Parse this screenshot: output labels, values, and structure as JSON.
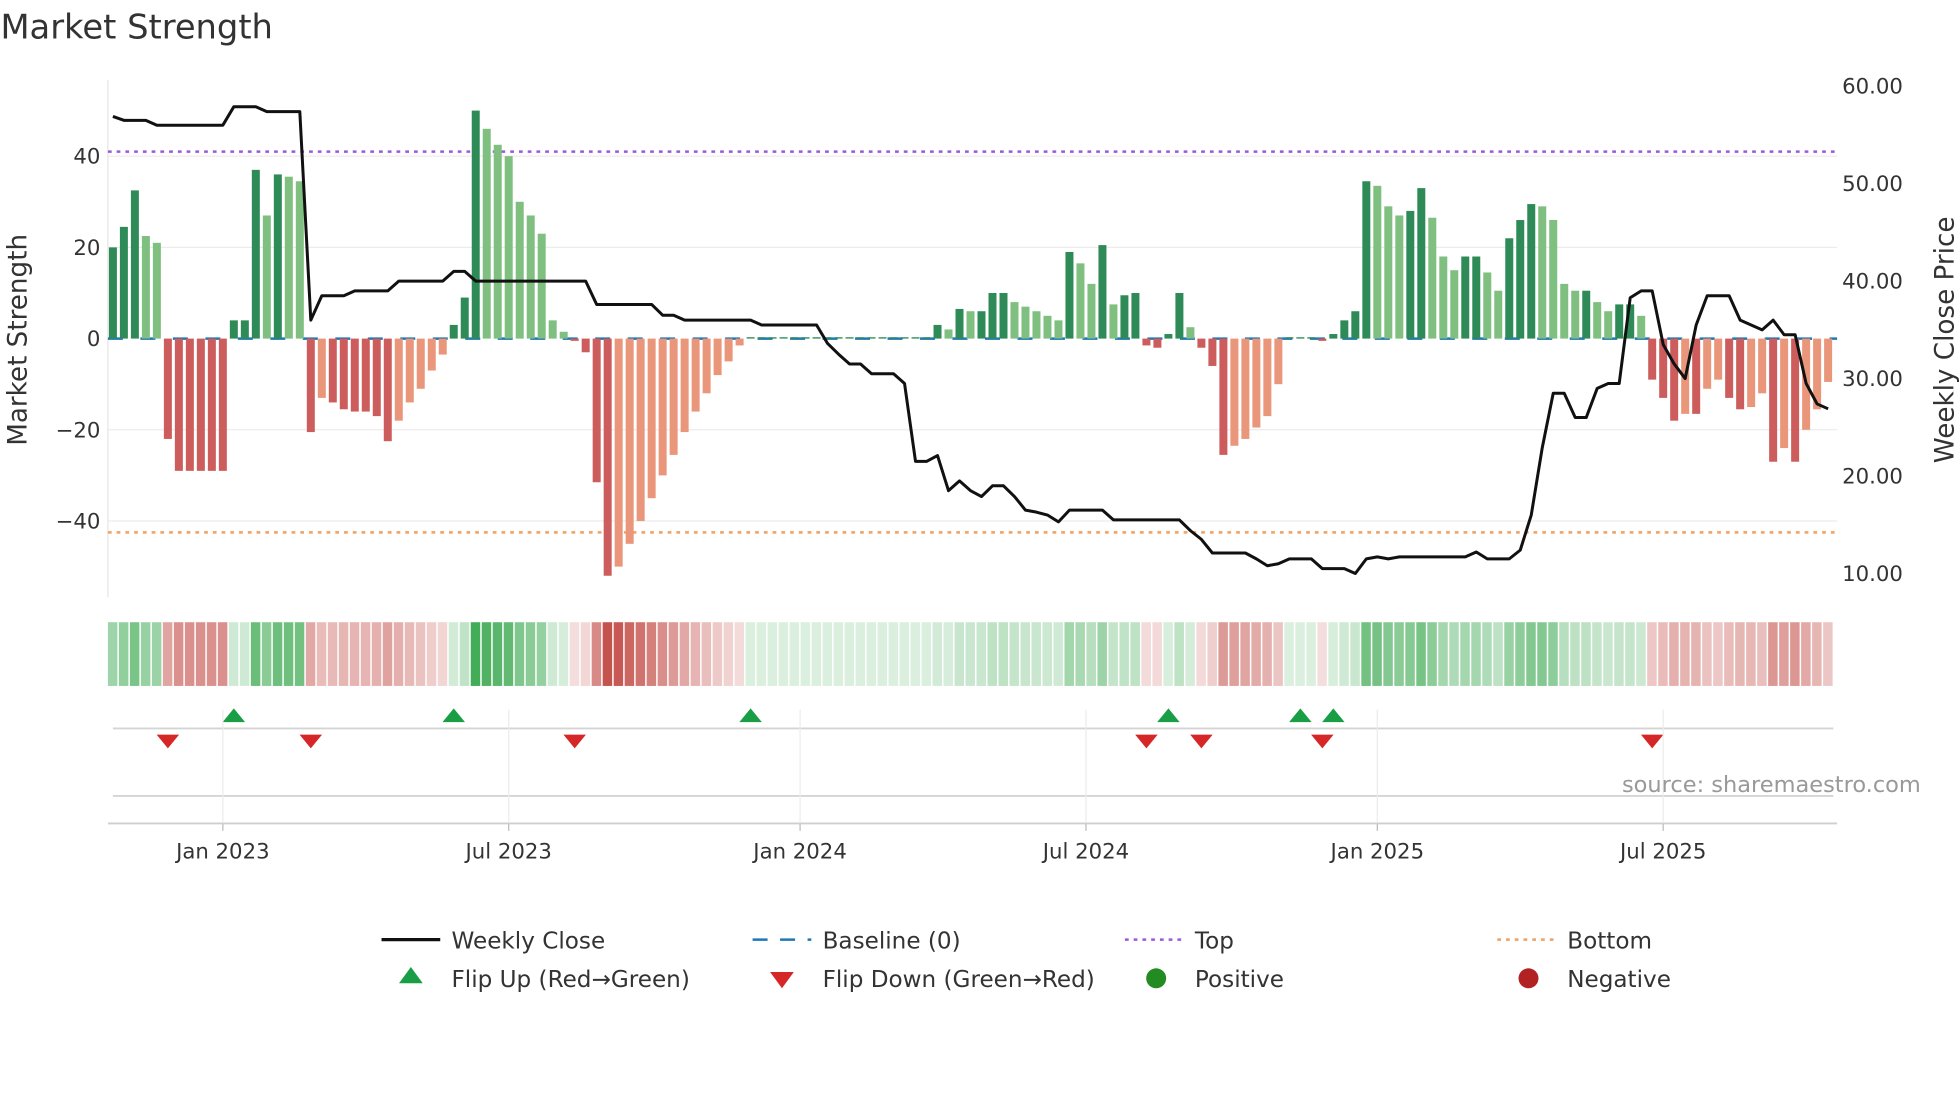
{
  "chart_data": {
    "type": "bar",
    "title": "Market Strength",
    "ylabel": "Market Strength",
    "y2label": "Weekly Close Price",
    "ylim": [
      -56,
      56
    ],
    "y2lim": [
      10,
      60
    ],
    "yticks": [
      40,
      20,
      0,
      -20,
      -40
    ],
    "ytick_labels": [
      "40",
      "20",
      "0",
      "−20",
      "−40"
    ],
    "y2ticks": [
      60,
      50,
      40,
      30,
      20,
      10
    ],
    "y2tick_labels": [
      "60.00",
      "50.00",
      "40.00",
      "30.00",
      "20.00",
      "10.00"
    ],
    "xtick_weeks": [
      10,
      36,
      62.5,
      88.5,
      115,
      141
    ],
    "xtick_labels": [
      "Jan 2023",
      "Jul 2023",
      "Jan 2024",
      "Jul 2024",
      "Jan 2025",
      "Jul 2025"
    ],
    "top_level": 41,
    "bottom_level": -42.5,
    "baseline": 0,
    "strength": [
      20,
      24.5,
      32.5,
      22.5,
      21,
      -22,
      -29,
      -29,
      -29,
      -29,
      -29,
      4,
      4,
      37,
      27,
      36,
      35.5,
      34.5,
      -20.5,
      -13,
      -14,
      -15.5,
      -16,
      -16,
      -17,
      -22.5,
      -18,
      -14,
      -11,
      -7,
      -3.5,
      3,
      9,
      50,
      46,
      42.5,
      40,
      30,
      27,
      23,
      4,
      1.5,
      -0.5,
      -3,
      -31.5,
      -52,
      -50,
      -45,
      -40,
      -35,
      -30,
      -25.5,
      -20.5,
      -16,
      -12,
      -8,
      -5,
      -1.5,
      0.3,
      0.3,
      0.3,
      0.3,
      0.3,
      0.3,
      0.3,
      0.3,
      0.3,
      0.3,
      0.3,
      0.3,
      0.3,
      0.3,
      0.3,
      0.3,
      0.3,
      3,
      2,
      6.5,
      6,
      6,
      10,
      10,
      8,
      7,
      6,
      5,
      4,
      19,
      16.5,
      12,
      20.5,
      7.5,
      9.5,
      10,
      -1.5,
      -2,
      1,
      10,
      2.5,
      -2,
      -6,
      -25.5,
      -23.5,
      -22,
      -19.5,
      -17,
      -10,
      0.3,
      0.3,
      0.3,
      -0.5,
      1,
      4,
      6,
      34.5,
      33.5,
      29,
      27,
      28,
      33,
      26.5,
      18,
      15,
      18,
      18,
      14.5,
      10.5,
      22,
      26,
      29.5,
      29,
      26,
      12,
      10.5,
      10.5,
      8,
      6,
      7.5,
      7.5,
      5,
      -9,
      -13,
      -18,
      -16.5,
      -16.5,
      -11,
      -9,
      -13,
      -15.5,
      -15,
      -12,
      -27,
      -24,
      -27,
      -20,
      -15.5,
      -9.5
    ],
    "weekly_close": [
      56.9,
      56.5,
      56.5,
      56.5,
      56.0,
      56.0,
      56.0,
      56.0,
      56.0,
      56.0,
      56.0,
      57.9,
      57.9,
      57.9,
      57.4,
      57.4,
      57.4,
      57.4,
      36.0,
      38.5,
      38.5,
      38.5,
      39.0,
      39.0,
      39.0,
      39.0,
      40.0,
      40.0,
      40.0,
      40.0,
      40.0,
      41.0,
      41.0,
      40.0,
      40.0,
      40.0,
      40.0,
      40.0,
      40.0,
      40.0,
      40.0,
      40.0,
      40.0,
      40.0,
      37.6,
      37.6,
      37.6,
      37.6,
      37.6,
      37.6,
      36.5,
      36.5,
      36.0,
      36.0,
      36.0,
      36.0,
      36.0,
      36.0,
      36.0,
      35.5,
      35.5,
      35.5,
      35.5,
      35.5,
      35.5,
      33.6,
      32.5,
      31.5,
      31.5,
      30.5,
      30.5,
      30.5,
      29.5,
      21.5,
      21.5,
      22.1,
      18.5,
      19.5,
      18.5,
      17.9,
      19.0,
      19.0,
      17.9,
      16.5,
      16.3,
      16.0,
      15.3,
      16.5,
      16.5,
      16.5,
      16.5,
      15.5,
      15.5,
      15.5,
      15.5,
      15.5,
      15.5,
      15.5,
      14.4,
      13.5,
      12.1,
      12.1,
      12.1,
      12.1,
      11.5,
      10.8,
      11.0,
      11.5,
      11.5,
      11.5,
      10.5,
      10.5,
      10.5,
      10.0,
      11.5,
      11.7,
      11.5,
      11.7,
      11.7,
      11.7,
      11.7,
      11.7,
      11.7,
      11.7,
      12.2,
      11.5,
      11.5,
      11.5,
      12.4,
      16.0,
      22.9,
      28.5,
      28.5,
      26.0,
      26.0,
      29.0,
      29.5,
      29.5,
      38.3,
      39.0,
      39.0,
      33.5,
      31.5,
      30.0,
      35.5,
      38.5,
      38.5,
      38.5,
      36.0,
      35.5,
      35.0,
      36.0,
      34.5,
      34.5,
      29.5,
      27.4,
      26.9
    ],
    "flip_up_weeks": [
      11,
      31,
      58,
      96,
      108,
      111
    ],
    "flip_down_weeks": [
      5,
      18,
      42,
      94,
      99,
      110,
      140
    ],
    "colors": {
      "pos_strong": "#2e8b57",
      "pos_weak": "#7fbf7f",
      "neg_strong": "#cd5c5c",
      "neg_weak": "#e9967a",
      "strip_pos": "#3aa84f",
      "strip_neg": "#c4504a",
      "close": "#111111",
      "baseline": "#1f77b4",
      "top": "#9b59d9",
      "bottom": "#f0a060",
      "flip_up": "#1a9e45",
      "flip_down": "#d62728",
      "positive": "#228b22",
      "negative": "#b22222"
    },
    "legend": {
      "placement": "bottom",
      "items": [
        "Weekly Close",
        "Baseline (0)",
        "Top",
        "Bottom",
        "Flip Up (Red→Green)",
        "Flip Down (Green→Red)",
        "Positive",
        "Negative"
      ]
    },
    "source": "source: sharemaestro.com"
  }
}
